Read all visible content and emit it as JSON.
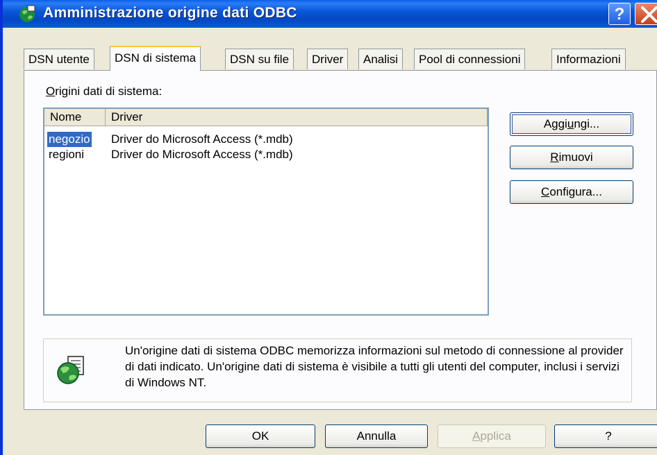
{
  "window": {
    "title": "Amministrazione origine dati ODBC",
    "help_glyph": "?"
  },
  "tabs": [
    {
      "label": "DSN utente",
      "active": false
    },
    {
      "label": "DSN di sistema",
      "active": true
    },
    {
      "label": "DSN su file",
      "active": false
    },
    {
      "label": "Driver",
      "active": false
    },
    {
      "label": "Analisi",
      "active": false
    },
    {
      "label": "Pool di connessioni",
      "active": false
    },
    {
      "label": "Informazioni",
      "active": false
    }
  ],
  "section": {
    "label_mnemonic": "O",
    "label_rest": "rigini dati di sistema:"
  },
  "list": {
    "columns": [
      "Nome",
      "Driver"
    ],
    "rows": [
      {
        "name": "negozio",
        "driver": "Driver do Microsoft Access (*.mdb)",
        "selected": true
      },
      {
        "name": "regioni",
        "driver": "Driver do Microsoft Access (*.mdb)",
        "selected": false
      }
    ]
  },
  "side_buttons": {
    "add": {
      "pre": "Aggi",
      "mnemonic": "u",
      "post": "ngi..."
    },
    "remove": {
      "pre": "",
      "mnemonic": "R",
      "post": "imuovi"
    },
    "configure": {
      "pre": "",
      "mnemonic": "C",
      "post": "onfigura..."
    }
  },
  "info": {
    "icon": "globe-database-icon",
    "text": "Un'origine dati di sistema ODBC memorizza informazioni sul metodo di connessione al provider di dati indicato. Un'origine dati di sistema è visibile a tutti gli utenti del computer, inclusi i servizi di Windows NT."
  },
  "footer_buttons": {
    "ok": "OK",
    "cancel": "Annulla",
    "apply_mnemonic": "A",
    "apply_rest": "pplica",
    "help": "?"
  },
  "colors": {
    "title_bar": "#0a57d8",
    "selection": "#316ac5",
    "active_tab_accent": "#ffc83c"
  }
}
